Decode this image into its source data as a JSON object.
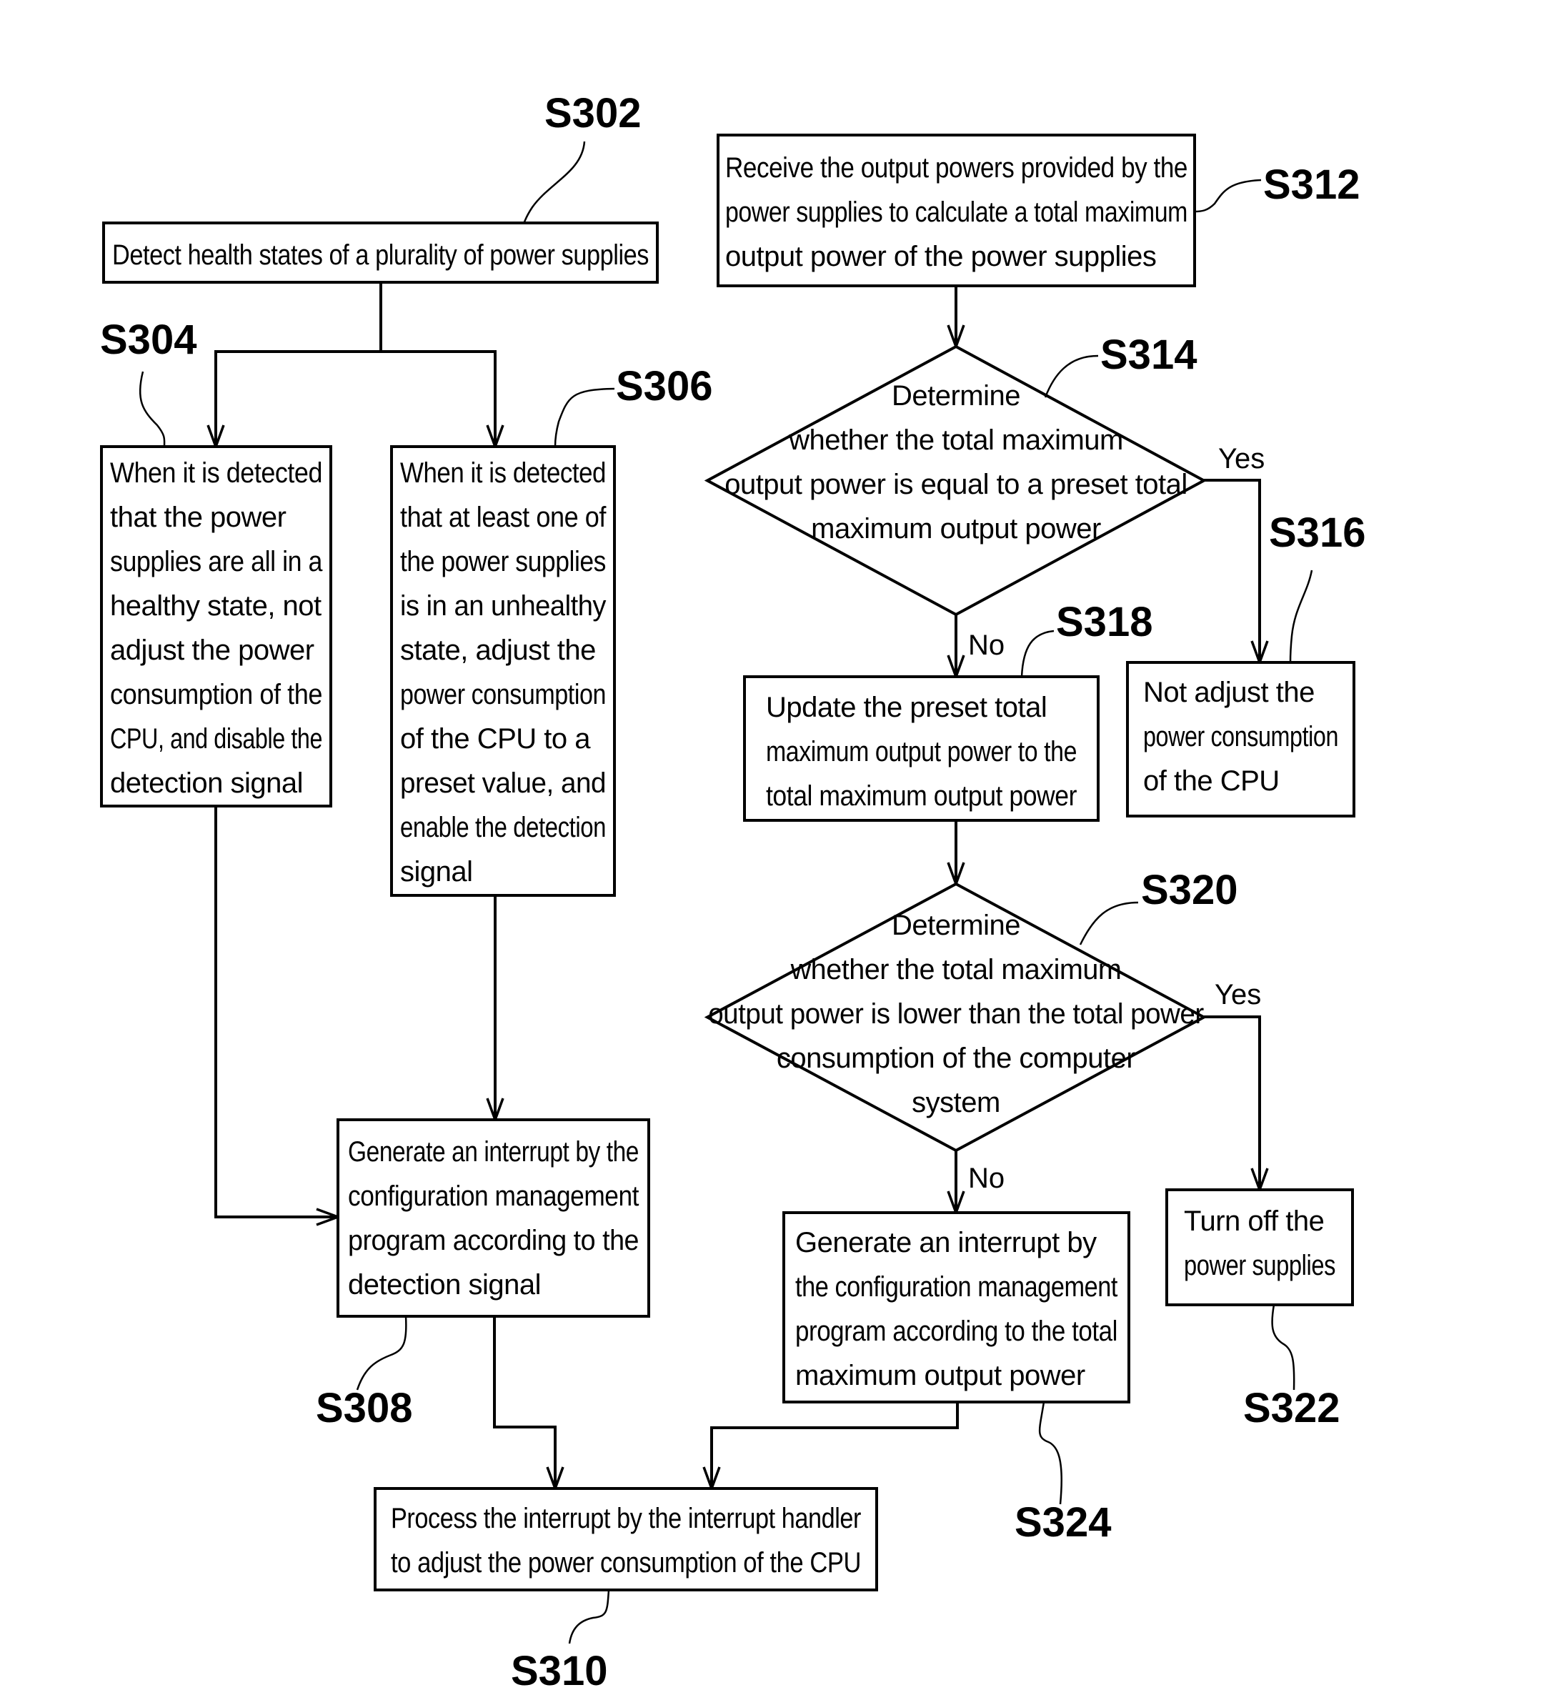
{
  "figure": {
    "nodes": [
      {
        "id": "S302",
        "type": "process",
        "lines": [
          "Detect health states of a plurality of power supplies"
        ]
      },
      {
        "id": "S304",
        "type": "process",
        "lines": [
          "When it is detected",
          "that the power",
          "supplies are all in a",
          "healthy state, not",
          "adjust the power",
          "consumption of the",
          "CPU, and disable the",
          "detection signal"
        ]
      },
      {
        "id": "S306",
        "type": "process",
        "lines": [
          "When it is detected",
          "that at least one of",
          "the power supplies",
          "is in an unhealthy",
          "state, adjust the",
          "power consumption",
          "of the CPU to a",
          "preset value, and",
          "enable the detection",
          "signal"
        ]
      },
      {
        "id": "S308",
        "type": "process",
        "lines": [
          "Generate an interrupt by the",
          "configuration management",
          "program according to the",
          "detection signal"
        ]
      },
      {
        "id": "S310",
        "type": "process",
        "lines": [
          "Process the interrupt by the interrupt handler",
          "to adjust the power consumption of the CPU"
        ]
      },
      {
        "id": "S312",
        "type": "process",
        "lines": [
          "Receive the output powers provided by the",
          "power supplies to calculate a total maximum",
          "output power of the power supplies"
        ]
      },
      {
        "id": "S314",
        "type": "decision",
        "lines": [
          "Determine",
          "whether the total maximum",
          "output power is equal to a preset total",
          "maximum output power"
        ]
      },
      {
        "id": "S316",
        "type": "process",
        "lines": [
          "Not adjust the",
          "power consumption",
          "of the CPU"
        ]
      },
      {
        "id": "S318",
        "type": "process",
        "lines": [
          "Update the preset total",
          "maximum output power to the",
          "total maximum output power"
        ]
      },
      {
        "id": "S320",
        "type": "decision",
        "lines": [
          "Determine",
          "whether the total maximum",
          "output power is lower than the total power",
          "consumption of the computer",
          "system"
        ]
      },
      {
        "id": "S322",
        "type": "process",
        "lines": [
          "Turn off the",
          "power supplies"
        ]
      },
      {
        "id": "S324",
        "type": "process",
        "lines": [
          "Generate an interrupt by",
          "the configuration management",
          "program according to the total",
          "maximum output power"
        ]
      }
    ],
    "edges": [
      {
        "from": "S302",
        "to": "S304",
        "label": ""
      },
      {
        "from": "S302",
        "to": "S306",
        "label": ""
      },
      {
        "from": "S304",
        "to": "S308",
        "label": ""
      },
      {
        "from": "S306",
        "to": "S308",
        "label": ""
      },
      {
        "from": "S308",
        "to": "S310",
        "label": ""
      },
      {
        "from": "S312",
        "to": "S314",
        "label": ""
      },
      {
        "from": "S314",
        "to": "S316",
        "label": "Yes"
      },
      {
        "from": "S314",
        "to": "S318",
        "label": "No"
      },
      {
        "from": "S318",
        "to": "S320",
        "label": ""
      },
      {
        "from": "S320",
        "to": "S322",
        "label": "Yes"
      },
      {
        "from": "S320",
        "to": "S324",
        "label": "No"
      },
      {
        "from": "S324",
        "to": "S310",
        "label": ""
      }
    ],
    "branch_labels": {
      "yes": "Yes",
      "no": "No"
    }
  }
}
